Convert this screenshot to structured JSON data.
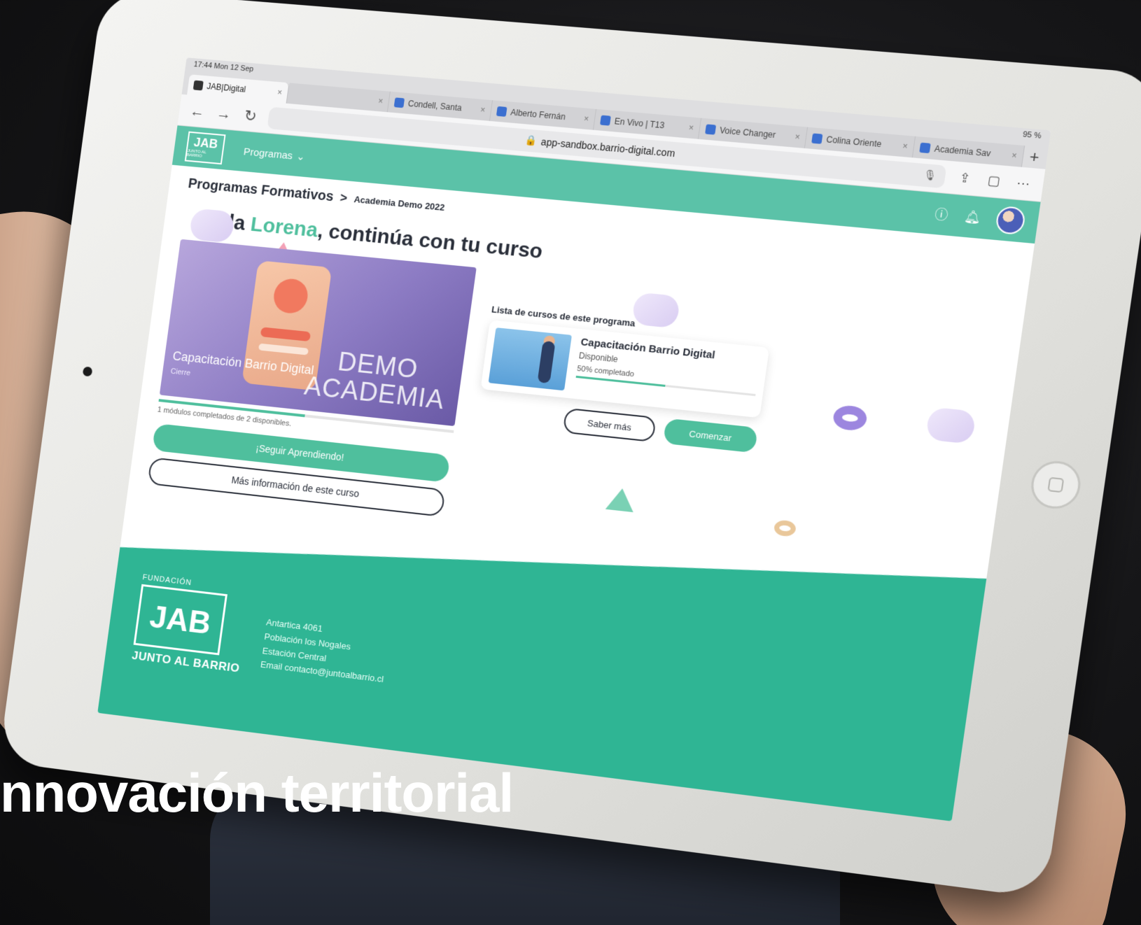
{
  "colors": {
    "accent": "#4fbf9d",
    "header": "#5bc2a8",
    "footer": "#2fb594",
    "text_dark": "#2a2f3a"
  },
  "device": {
    "status_time": "17:44  Mon 12 Sep",
    "battery": "95 %"
  },
  "browser": {
    "tabs": [
      {
        "label": "JAB|Digital",
        "close": "×"
      },
      {
        "label": "",
        "close": "×"
      },
      {
        "label": "Condell, Santa",
        "close": "×"
      },
      {
        "label": "Alberto Fernán",
        "close": "×"
      },
      {
        "label": "En Vivo | T13",
        "close": "×"
      },
      {
        "label": "Voice Changer",
        "close": "×"
      },
      {
        "label": "Colina Oriente",
        "close": "×"
      },
      {
        "label": "Academia Sav",
        "close": "×"
      }
    ],
    "new_tab": "+",
    "url": "app-sandbox.barrio-digital.com",
    "icons": [
      "back-icon",
      "forward-icon",
      "reload-icon",
      "mic-icon",
      "share-icon",
      "tabs-icon",
      "more-icon"
    ]
  },
  "site": {
    "logo_big": "JAB",
    "logo_small": "JUNTO AL BARRIO",
    "nav_programs": "Programas",
    "breadcrumb": {
      "root": "Programas Formativos",
      "separator": ">",
      "current": "Academia Demo 2022"
    },
    "greeting_prefix": "Hola ",
    "greeting_name": "Lorena",
    "greeting_suffix": ", continúa con tu curso",
    "current_course": {
      "title": "Capacitación Barrio Digital",
      "subtitle": "Cierre",
      "hero_line1": "DEMO",
      "hero_line2": "ACADEMIA",
      "progress_fraction": 0.5,
      "progress_text": "1 módulos completados de 2 disponibles.",
      "primary_button": "¡Seguir Aprendiendo!",
      "secondary_button": "Más información de este curso"
    },
    "course_list": {
      "title": "Lista de cursos de este programa",
      "items": [
        {
          "name": "Capacitación Barrio Digital",
          "status": "Disponible",
          "progress_label": "50% completado",
          "progress_fraction": 0.5,
          "secondary_button": "Saber más",
          "primary_button": "Comenzar"
        }
      ]
    },
    "footer": {
      "kicker": "FUNDACIÓN",
      "logo_big": "JAB",
      "logo_tag": "JUNTO AL BARRIO",
      "address_1": "Antartica 4061",
      "address_2": "Población los Nogales",
      "address_3": "Estación Central",
      "email": "Email contacto@juntoalbarrio.cl"
    }
  },
  "caption": "nnovación territorial"
}
